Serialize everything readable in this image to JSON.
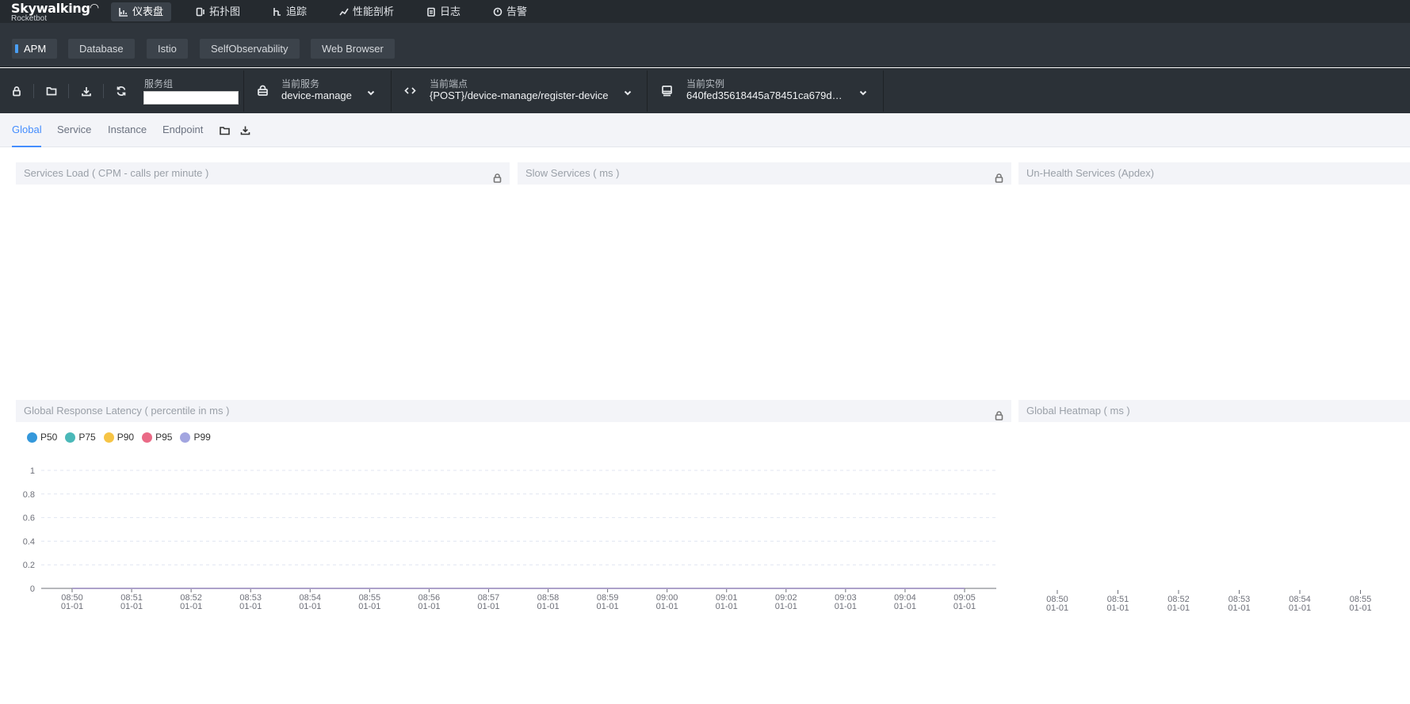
{
  "app": {
    "brand": "Skywalking",
    "sub": "Rocketbot"
  },
  "nav": [
    {
      "label": "仪表盘",
      "icon": "dashboard-icon",
      "active": true
    },
    {
      "label": "拓扑图",
      "icon": "topology-icon"
    },
    {
      "label": "追踪",
      "icon": "trace-icon"
    },
    {
      "label": "性能剖析",
      "icon": "profile-icon"
    },
    {
      "label": "日志",
      "icon": "log-icon"
    },
    {
      "label": "告警",
      "icon": "alarm-icon"
    }
  ],
  "layers": [
    {
      "label": "APM",
      "active": true
    },
    {
      "label": "Database"
    },
    {
      "label": "Istio"
    },
    {
      "label": "SelfObservability"
    },
    {
      "label": "Web Browser"
    }
  ],
  "selectors": {
    "group": {
      "label": "服务组",
      "value": ""
    },
    "service": {
      "label": "当前服务",
      "value": "device-manage"
    },
    "endpoint": {
      "label": "当前端点",
      "value": "{POST}/device-manage/register-device"
    },
    "instance": {
      "label": "当前实例",
      "value": "640fed35618445a78451ca679d…"
    }
  },
  "tabs": [
    {
      "label": "Global",
      "active": true
    },
    {
      "label": "Service"
    },
    {
      "label": "Instance"
    },
    {
      "label": "Endpoint"
    }
  ],
  "panels": {
    "services_load": "Services Load ( CPM - calls per minute )",
    "slow_services": "Slow Services ( ms )",
    "unhealth_services": "Un-Health Services (Apdex)",
    "global_latency": "Global Response Latency ( percentile in ms )",
    "global_heatmap": "Global Heatmap ( ms )"
  },
  "colors": {
    "accent": "#448dfe",
    "p50": "#3498db",
    "p75": "#4ab8b8",
    "p90": "#f6c445",
    "p95": "#ea6a86",
    "p99": "#a2a5e0"
  },
  "chart_data": [
    {
      "type": "line",
      "title": "Global Response Latency ( percentile in ms )",
      "categories": [
        "08:50\n01-01",
        "08:51\n01-01",
        "08:52\n01-01",
        "08:53\n01-01",
        "08:54\n01-01",
        "08:55\n01-01",
        "08:56\n01-01",
        "08:57\n01-01",
        "08:58\n01-01",
        "08:59\n01-01",
        "09:00\n01-01",
        "09:01\n01-01",
        "09:02\n01-01",
        "09:03\n01-01",
        "09:04\n01-01",
        "09:05\n01-01"
      ],
      "series": [
        {
          "name": "P50",
          "values": [
            0,
            0,
            0,
            0,
            0,
            0,
            0,
            0,
            0,
            0,
            0,
            0,
            0,
            0,
            0,
            0
          ]
        },
        {
          "name": "P75",
          "values": [
            0,
            0,
            0,
            0,
            0,
            0,
            0,
            0,
            0,
            0,
            0,
            0,
            0,
            0,
            0,
            0
          ]
        },
        {
          "name": "P90",
          "values": [
            0,
            0,
            0,
            0,
            0,
            0,
            0,
            0,
            0,
            0,
            0,
            0,
            0,
            0,
            0,
            0
          ]
        },
        {
          "name": "P95",
          "values": [
            0,
            0,
            0,
            0,
            0,
            0,
            0,
            0,
            0,
            0,
            0,
            0,
            0,
            0,
            0,
            0
          ]
        },
        {
          "name": "P99",
          "values": [
            0,
            0,
            0,
            0,
            0,
            0,
            0,
            0,
            0,
            0,
            0,
            0,
            0,
            0,
            0,
            0
          ]
        }
      ],
      "yticks": [
        "0",
        "0.2",
        "0.4",
        "0.6",
        "0.8",
        "1"
      ],
      "ylim": [
        0,
        1
      ],
      "grid": true,
      "legend": "top-left"
    },
    {
      "type": "heatmap",
      "title": "Global Heatmap ( ms )",
      "categories": [
        "08:50\n01-01",
        "08:51\n01-01",
        "08:52\n01-01",
        "08:53\n01-01",
        "08:54\n01-01",
        "08:55\n01-01"
      ],
      "values": []
    }
  ]
}
